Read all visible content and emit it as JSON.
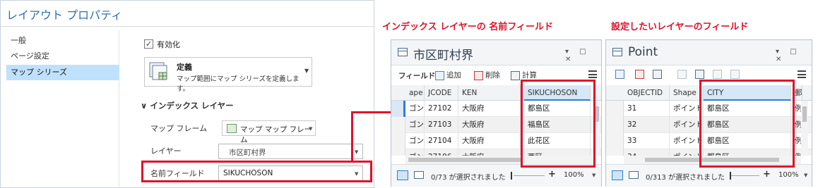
{
  "layout_properties": {
    "title": "レイアウト プロパティ",
    "nav": [
      "一般",
      "ページ設定",
      "マップ シリーズ"
    ],
    "enable_label": "有効化",
    "define_title": "定義",
    "define_desc": "マップ範囲にマップ シリーズを定義します。",
    "index_header": "インデックス レイヤー",
    "mapframe_label": "マップ フレーム",
    "mapframe_value": "マップ マップ フレーム",
    "layer_label": "レイヤー",
    "layer_value": "市区町村界",
    "namefield_label": "名前フィールド",
    "namefield_value": "SIKUCHOSON"
  },
  "annotations": {
    "left": "インデックス レイヤーの 名前フィールド",
    "right": "設定したいレイヤーのフィールド"
  },
  "table1": {
    "title": "市区町村界",
    "controls": "▾ □ ✕",
    "field_label": "フィールド:",
    "buttons": [
      "追加",
      "削除",
      "計算"
    ],
    "columns": [
      "ape",
      "JCODE",
      "KEN",
      "SIKUCHOSON"
    ],
    "rows": [
      [
        "ゴン",
        "27102",
        "大阪府",
        "都島区"
      ],
      [
        "ゴン",
        "27103",
        "大阪府",
        "福島区"
      ],
      [
        "ゴン",
        "27104",
        "大阪府",
        "此花区"
      ],
      [
        "ゴン",
        "27106",
        "大阪府",
        "西区"
      ]
    ],
    "status": "0/73 が選択されました",
    "zoom": "100%"
  },
  "table2": {
    "title": "Point",
    "controls": "▾ □ ✕",
    "columns": [
      "OBJECTID",
      "Shape",
      "CITY",
      "郵"
    ],
    "rows": [
      [
        "31",
        "ポイント",
        "都島区",
        "例"
      ],
      [
        "32",
        "ポイント",
        "都島区",
        "例"
      ],
      [
        "33",
        "ポイント",
        "都島区",
        "例"
      ],
      [
        "34",
        "ポイント",
        "都島区",
        "例"
      ]
    ],
    "status": "0/313 が選択されました",
    "zoom": "100%"
  },
  "colors": {
    "highlight_red": "#e0102a",
    "title_blue": "#2f6fab",
    "selection_blue": "#bfe1fb"
  },
  "icons": [
    "checkbox-icon",
    "map-series-icon",
    "map-frame-icon",
    "table-icon",
    "add-field-icon",
    "delete-field-icon",
    "calculate-field-icon",
    "menu-icon",
    "table-view-icon",
    "selection-view-icon"
  ]
}
